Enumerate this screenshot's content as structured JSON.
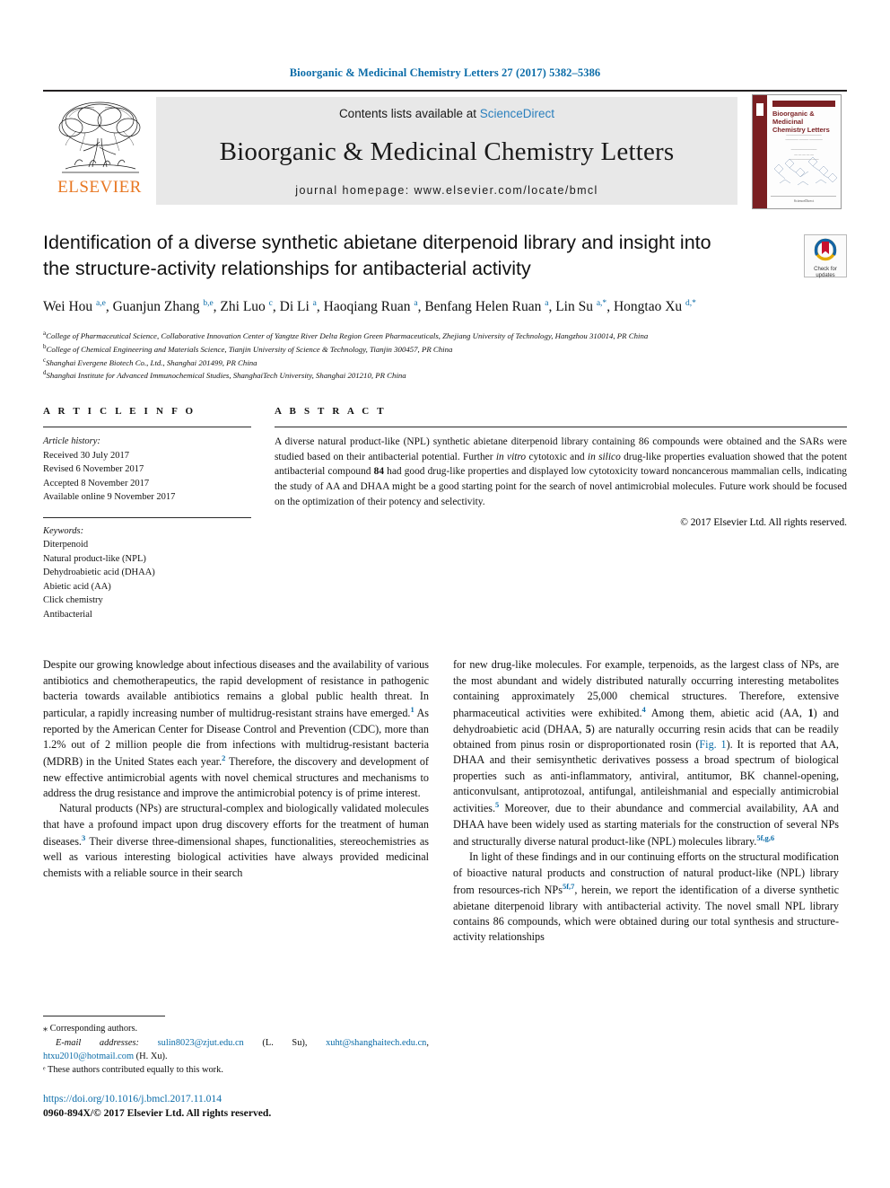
{
  "running_head": "Bioorganic & Medicinal Chemistry Letters 27 (2017) 5382–5386",
  "banner": {
    "publisher": "ELSEVIER",
    "contents_prefix": "Contents lists available at ",
    "contents_link": "ScienceDirect",
    "journal_title": "Bioorganic & Medicinal Chemistry Letters",
    "homepage": "journal homepage: www.elsevier.com/locate/bmcl",
    "cover_title": "Bioorganic & Medicinal Chemistry Letters",
    "cover_footer": "ScienceDirect"
  },
  "article": {
    "title": "Identification of a diverse synthetic abietane diterpenoid library and insight into the structure-activity relationships for antibacterial activity",
    "crossmark_label_line1": "Check for",
    "crossmark_label_line2": "updates",
    "authors_line1": "Wei Hou",
    "authors_html": "Wei Hou <sup>a,e</sup>, Guanjun Zhang <sup>b,e</sup>, Zhi Luo <sup>c</sup>, Di Li <sup>a</sup>, Haoqiang Ruan <sup>a</sup>, Benfang Helen Ruan <sup>a</sup>, Lin Su <sup>a,*</sup>, Hongtao Xu <sup>d,*</sup>",
    "affiliations": [
      {
        "mark": "a",
        "text": "College of Pharmaceutical Science, Collaborative Innovation Center of Yangtze River Delta Region Green Pharmaceuticals, Zhejiang University of Technology, Hangzhou 310014, PR China"
      },
      {
        "mark": "b",
        "text": "College of Chemical Engineering and Materials Science, Tianjin University of Science & Technology, Tianjin 300457, PR China"
      },
      {
        "mark": "c",
        "text": "Shanghai Evergene Biotech Co., Ltd., Shanghai 201499, PR China"
      },
      {
        "mark": "d",
        "text": "Shanghai Institute for Advanced Immunochemical Studies, ShanghaiTech University, Shanghai 201210, PR China"
      }
    ]
  },
  "article_info": {
    "heading": "A R T I C L E   I N F O",
    "history_label": "Article history:",
    "history": [
      "Received 30 July 2017",
      "Revised 6 November 2017",
      "Accepted 8 November 2017",
      "Available online 9 November 2017"
    ],
    "keywords_label": "Keywords:",
    "keywords": [
      "Diterpenoid",
      "Natural product-like (NPL)",
      "Dehydroabietic acid (DHAA)",
      "Abietic acid (AA)",
      "Click chemistry",
      "Antibacterial"
    ]
  },
  "abstract": {
    "heading": "A B S T R A C T",
    "text_html": "A diverse natural product-like (NPL) synthetic abietane diterpenoid library containing 86 compounds were obtained and the SARs were studied based on their antibacterial potential. Further <i>in vitro</i> cytotoxic and <i>in silico</i> drug-like properties evaluation showed that the potent antibacterial compound <b>84</b> had good drug-like properties and displayed low cytotoxicity toward noncancerous mammalian cells, indicating the study of AA and DHAA might be a good starting point for the search of novel antimicrobial molecules. Future work should be focused on the optimization of their potency and selectivity.",
    "copyright": "© 2017 Elsevier Ltd. All rights reserved."
  },
  "body": {
    "left_column": [
      "Despite our growing knowledge about infectious diseases and the availability of various antibiotics and chemotherapeutics, the rapid development of resistance in pathogenic bacteria towards available antibiotics remains a global public health threat. In particular, a rapidly increasing number of multidrug-resistant strains have emerged.<sup class=\"ref\">1</sup> As reported by the American Center for Disease Control and Prevention (CDC), more than 1.2% out of 2 million people die from infections with multidrug-resistant bacteria (MDRB) in the United States each year.<sup class=\"ref\">2</sup> Therefore, the discovery and development of new effective antimicrobial agents with novel chemical structures and mechanisms to address the drug resistance and improve the antimicrobial potency is of prime interest.",
      "Natural products (NPs) are structural-complex and biologically validated molecules that have a profound impact upon drug discovery efforts for the treatment of human diseases.<sup class=\"ref\">3</sup> Their diverse three-dimensional shapes, functionalities, stereochemistries as well as various interesting biological activities have always provided medicinal chemists with a reliable source in their search"
    ],
    "right_column": [
      "for new drug-like molecules. For example, terpenoids, as the largest class of NPs, are the most abundant and widely distributed naturally occurring interesting metabolites containing approximately 25,000 chemical structures. Therefore, extensive pharmaceutical activities were exhibited.<sup class=\"ref\">4</sup> Among them, abietic acid (AA, <b>1</b>) and dehydroabietic acid (DHAA, <b>5</b>) are naturally occurring resin acids that can be readily obtained from pinus rosin or disproportionated rosin (<span class=\"lnk\">Fig. 1</span>). It is reported that AA, DHAA and their semisynthetic derivatives possess a broad spectrum of biological properties such as anti-inflammatory, antiviral, antitumor, BK channel-opening, anticonvulsant, antiprotozoal, antifungal, antileishmanial and especially antimicrobial activities.<sup class=\"ref\">5</sup> Moreover, due to their abundance and commercial availability, AA and DHAA have been widely used as starting materials for the construction of several NPs and structurally diverse natural product-like (NPL) molecules library.<sup class=\"ref\">5f,g,6</sup>",
      "In light of these findings and in our continuing efforts on the structural modification of bioactive natural products and construction of natural product-like (NPL) library from resources-rich NPs<sup class=\"ref\">5f,7</sup>, herein, we report the identification of a diverse synthetic abietane diterpenoid library with antibacterial activity. The novel small NPL library contains 86 compounds, which were obtained during our total synthesis and structure-activity relationships"
    ]
  },
  "footnotes": {
    "corresponding": "Corresponding authors.",
    "email_label": "E-mail addresses:",
    "emails_html": "<span class=\"lnk\">sulin8023@zjut.edu.cn</span> (L. Su), <span class=\"lnk\">xuht@shanghaitech.edu.cn</span>, <span class=\"lnk\">htxu2010@hotmail.com</span> (H. Xu).",
    "equal_contribution": "These authors contributed equally to this work.",
    "doi": "https://doi.org/10.1016/j.bmcl.2017.11.014",
    "issn": "0960-894X/© 2017 Elsevier Ltd. All rights reserved."
  },
  "colors": {
    "link": "#0b6ca8",
    "elsevier_orange": "#e87722",
    "banner_grey": "#e8e8e8",
    "cover_red": "#7a1f22"
  }
}
